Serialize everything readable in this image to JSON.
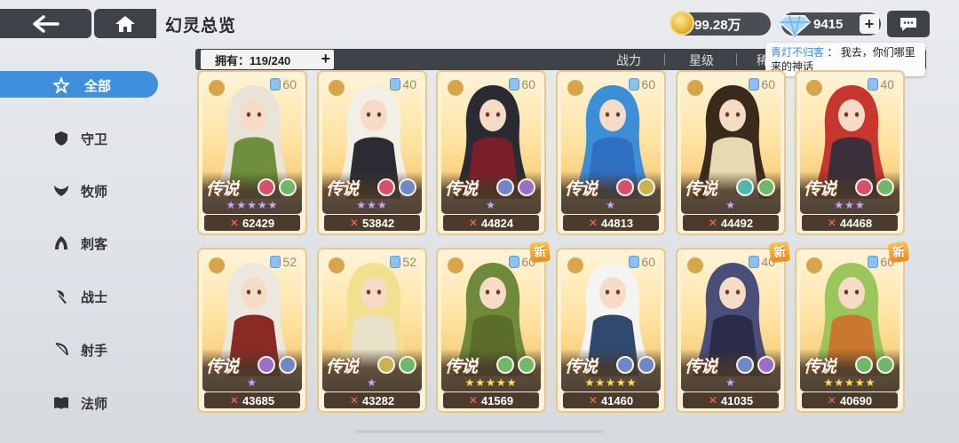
{
  "header": {
    "title": "幻灵总览",
    "gold": "99.28万",
    "gems": "9415",
    "plus_label": "+"
  },
  "sort_bar": {
    "owned_label": "拥有：119/240",
    "owned_plus": "+",
    "options": [
      "战力",
      "星级",
      "稀"
    ]
  },
  "chat_tip": {
    "sender": "青灯不归客",
    "separator": "：",
    "message": "我去，你们哪里来的神话"
  },
  "sidebar": {
    "items": [
      {
        "label": "全部",
        "icon": "all-star-icon",
        "active": true
      },
      {
        "label": "守卫",
        "icon": "shield-icon",
        "active": false
      },
      {
        "label": "牧师",
        "icon": "wing-icon",
        "active": false
      },
      {
        "label": "刺客",
        "icon": "hood-icon",
        "active": false
      },
      {
        "label": "战士",
        "icon": "axe-icon",
        "active": false
      },
      {
        "label": "射手",
        "icon": "bow-icon",
        "active": false
      },
      {
        "label": "法师",
        "icon": "book-icon",
        "active": false
      }
    ]
  },
  "cards": [
    {
      "level": "60",
      "rarity": "传说",
      "stars": "★★★★★",
      "star_color": "purple",
      "power": "62429",
      "new": false,
      "skills": [
        "#d94f6a",
        "#6fb86a"
      ],
      "hair": "#e9e4d8",
      "outfit": "#6f8f3c"
    },
    {
      "level": "40",
      "rarity": "传说",
      "stars": "★★★",
      "star_color": "purple",
      "power": "53842",
      "new": false,
      "skills": [
        "#d94f6a",
        "#6f86c9"
      ],
      "hair": "#f2efe6",
      "outfit": "#2d2a33"
    },
    {
      "level": "60",
      "rarity": "传说",
      "stars": "★",
      "star_color": "purple",
      "power": "44824",
      "new": false,
      "skills": [
        "#6f86c9",
        "#9a6fc9"
      ],
      "hair": "#2a2a32",
      "outfit": "#7a1f2a"
    },
    {
      "level": "60",
      "rarity": "传说",
      "stars": "★",
      "star_color": "purple",
      "power": "44813",
      "new": false,
      "skills": [
        "#d94f6a",
        "#c9b24f"
      ],
      "hair": "#3c8fd6",
      "outfit": "#2f6fc2"
    },
    {
      "level": "60",
      "rarity": "传说",
      "stars": "★",
      "star_color": "purple",
      "power": "44492",
      "new": false,
      "skills": [
        "#4fb7b0",
        "#6fb86a"
      ],
      "hair": "#3a2a1c",
      "outfit": "#e9d9b0"
    },
    {
      "level": "40",
      "rarity": "传说",
      "stars": "★★★",
      "star_color": "purple",
      "power": "44468",
      "new": false,
      "skills": [
        "#d94f6a",
        "#6fb86a"
      ],
      "hair": "#c7362f",
      "outfit": "#3a2f3a"
    },
    {
      "level": "52",
      "rarity": "传说",
      "stars": "★",
      "star_color": "purple",
      "power": "43685",
      "new": false,
      "skills": [
        "#9a6fc9",
        "#6f86c9"
      ],
      "hair": "#ece8df",
      "outfit": "#8a2a24"
    },
    {
      "level": "52",
      "rarity": "传说",
      "stars": "★",
      "star_color": "purple",
      "power": "43282",
      "new": false,
      "skills": [
        "#c9b24f",
        "#6fb86a"
      ],
      "hair": "#f3e08e",
      "outfit": "#e9e2c8"
    },
    {
      "level": "60",
      "rarity": "传说",
      "stars": "★★★★★",
      "star_color": "gold",
      "power": "41569",
      "new": true,
      "skills": [
        "#6fb86a",
        "#6fb86a"
      ],
      "hair": "#6f8a3a",
      "outfit": "#5a6e2a"
    },
    {
      "level": "60",
      "rarity": "传说",
      "stars": "★★★★★",
      "star_color": "gold",
      "power": "41460",
      "new": false,
      "skills": [
        "#6f86c9",
        "#6f86c9"
      ],
      "hair": "#f4f4f2",
      "outfit": "#2f4a6e"
    },
    {
      "level": "40",
      "rarity": "传说",
      "stars": "★",
      "star_color": "purple",
      "power": "41035",
      "new": true,
      "skills": [
        "#6f86c9",
        "#9a6fc9"
      ],
      "hair": "#4a4f7a",
      "outfit": "#2a2c4a"
    },
    {
      "level": "60",
      "rarity": "传说",
      "stars": "★★★★★",
      "star_color": "gold",
      "power": "40690",
      "new": true,
      "skills": [
        "#6fb86a",
        "#6fb86a"
      ],
      "hair": "#9ac65a",
      "outfit": "#c9782f"
    }
  ],
  "new_badge_label": "新",
  "colors": {
    "accent": "#3e8fdc",
    "panel": "#3f4246",
    "card_border": "#e8c884"
  }
}
